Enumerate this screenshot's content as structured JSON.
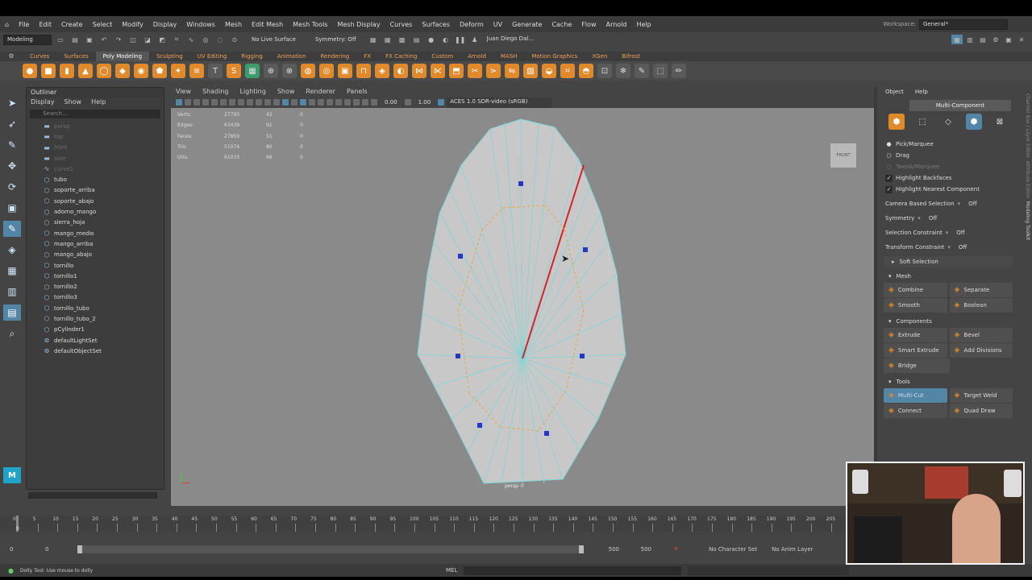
{
  "menubar": [
    "File",
    "Edit",
    "Create",
    "Select",
    "Modify",
    "Display",
    "Windows",
    "Mesh",
    "Edit Mesh",
    "Mesh Tools",
    "Mesh Display",
    "Curves",
    "Surfaces",
    "Deform",
    "UV",
    "Generate",
    "Cache",
    "Flow",
    "Arnold",
    "Help"
  ],
  "workspace": {
    "label": "Workspace:",
    "value": "General*"
  },
  "status": {
    "mode": "Modeling",
    "live_surface": "No Live Surface",
    "symmetry": "Symmetry: Off",
    "user": "Juan Diego Dal..."
  },
  "shelf_tabs": [
    "Curves",
    "Surfaces",
    "Poly Modeling",
    "Sculpting",
    "UV Editing",
    "Rigging",
    "Animation",
    "Rendering",
    "FX",
    "FX Caching",
    "Custom",
    "Arnold",
    "MASH",
    "Motion Graphics",
    "XGen",
    "Bifrost"
  ],
  "shelf_active": "Poly Modeling",
  "outliner": {
    "title": "Outliner",
    "menus": [
      "Display",
      "Show",
      "Help"
    ],
    "search_placeholder": "Search...",
    "items": [
      {
        "name": "persp",
        "dim": true,
        "icon": "camera"
      },
      {
        "name": "top",
        "dim": true,
        "icon": "camera"
      },
      {
        "name": "front",
        "dim": true,
        "icon": "camera"
      },
      {
        "name": "side",
        "dim": true,
        "icon": "camera"
      },
      {
        "name": "curve1",
        "dim": true,
        "icon": "curve"
      },
      {
        "name": "tubo",
        "dim": false,
        "icon": "mesh"
      },
      {
        "name": "soporte_arriba",
        "dim": false,
        "icon": "mesh"
      },
      {
        "name": "soporte_abajo",
        "dim": false,
        "icon": "mesh"
      },
      {
        "name": "adorno_mango",
        "dim": false,
        "icon": "mesh"
      },
      {
        "name": "sierra_hoja",
        "dim": false,
        "icon": "mesh"
      },
      {
        "name": "mango_medio",
        "dim": false,
        "icon": "mesh"
      },
      {
        "name": "mango_arriba",
        "dim": false,
        "icon": "mesh"
      },
      {
        "name": "mango_abajo",
        "dim": false,
        "icon": "mesh"
      },
      {
        "name": "tornillo",
        "dim": false,
        "icon": "mesh"
      },
      {
        "name": "tornillo1",
        "dim": false,
        "icon": "mesh"
      },
      {
        "name": "tornillo2",
        "dim": false,
        "icon": "mesh"
      },
      {
        "name": "tornillo3",
        "dim": false,
        "icon": "mesh"
      },
      {
        "name": "tornillo_tubo",
        "dim": false,
        "icon": "mesh"
      },
      {
        "name": "tornillo_tubo_2",
        "dim": false,
        "icon": "mesh"
      },
      {
        "name": "pCylinder1",
        "dim": false,
        "icon": "mesh"
      },
      {
        "name": "defaultLightSet",
        "dim": false,
        "icon": "set"
      },
      {
        "name": "defaultObjectSet",
        "dim": false,
        "icon": "set"
      }
    ]
  },
  "viewport": {
    "menus": [
      "View",
      "Shading",
      "Lighting",
      "Show",
      "Renderer",
      "Panels"
    ],
    "exposure": "0.00",
    "gamma": "1.00",
    "color_space": "ACES 1.0 SDR-video (sRGB)",
    "camera_label": "persp -Y",
    "view_cube": "FRONT",
    "hud": [
      {
        "label": "Verts:",
        "a": "27793",
        "b": "42",
        "c": "0"
      },
      {
        "label": "Edges:",
        "a": "63439",
        "b": "91",
        "c": "0"
      },
      {
        "label": "Faces:",
        "a": "27850",
        "b": "51",
        "c": "0"
      },
      {
        "label": "Tris:",
        "a": "51074",
        "b": "80",
        "c": "0"
      },
      {
        "label": "UVs:",
        "a": "61033",
        "b": "66",
        "c": "0"
      }
    ]
  },
  "modeling_toolkit": {
    "tabs": [
      "Object",
      "Help"
    ],
    "mode": "Multi-Component",
    "options": [
      {
        "label": "Pick/Marquee",
        "type": "radio",
        "on": true,
        "dim": false
      },
      {
        "label": "Drag",
        "type": "radio",
        "on": false,
        "dim": false
      },
      {
        "label": "Tweak/Marquee",
        "type": "radio",
        "on": false,
        "dim": true
      },
      {
        "label": "Highlight Backfaces",
        "type": "check",
        "on": true,
        "dim": false
      },
      {
        "label": "Highlight Nearest Component",
        "type": "check",
        "on": true,
        "dim": false
      }
    ],
    "settings": [
      {
        "label": "Camera Based Selection",
        "value": "Off"
      },
      {
        "label": "Symmetry",
        "value": "Off"
      },
      {
        "label": "Selection Constraint",
        "value": "Off"
      },
      {
        "label": "Transform Constraint",
        "value": "Off"
      }
    ],
    "soft_selection": "Soft Selection",
    "sections": [
      {
        "title": "Mesh",
        "rows": [
          [
            "Combine",
            "Separate"
          ],
          [
            "Smooth",
            "Boolean"
          ]
        ]
      },
      {
        "title": "Components",
        "rows": [
          [
            "Extrude",
            "Bevel"
          ],
          [
            "Smart Extrude",
            "Add Divisions"
          ],
          [
            "Bridge",
            ""
          ]
        ]
      },
      {
        "title": "Tools",
        "rows": [
          [
            "Multi-Cut",
            "Target Weld"
          ],
          [
            "Connect",
            "Quad Draw"
          ]
        ]
      }
    ],
    "active_tool": "Multi-Cut"
  },
  "timeline": {
    "ticks": [
      "0",
      "5",
      "10",
      "15",
      "20",
      "25",
      "30",
      "35",
      "40",
      "45",
      "50",
      "55",
      "60",
      "65",
      "70",
      "75",
      "80",
      "85",
      "90",
      "95",
      "100",
      "105",
      "110",
      "115",
      "120",
      "125",
      "130",
      "135",
      "140",
      "145",
      "150",
      "155",
      "160",
      "165",
      "170",
      "175",
      "180",
      "185",
      "190",
      "195",
      "200",
      "205"
    ],
    "current": "0"
  },
  "range": {
    "start": "0",
    "start2": "0",
    "end": "500",
    "end2": "500",
    "character_set": "No Character Set",
    "anim_layer": "No Anim Layer"
  },
  "helpline": {
    "text": "Dolly Tool: Use mouse to dolly",
    "script_type": "MEL"
  },
  "colors": {
    "accent": "#5285a6",
    "shelf_orange": "#e08a2c",
    "wire": "#7fd6d6",
    "edge_red": "#d8202a"
  }
}
